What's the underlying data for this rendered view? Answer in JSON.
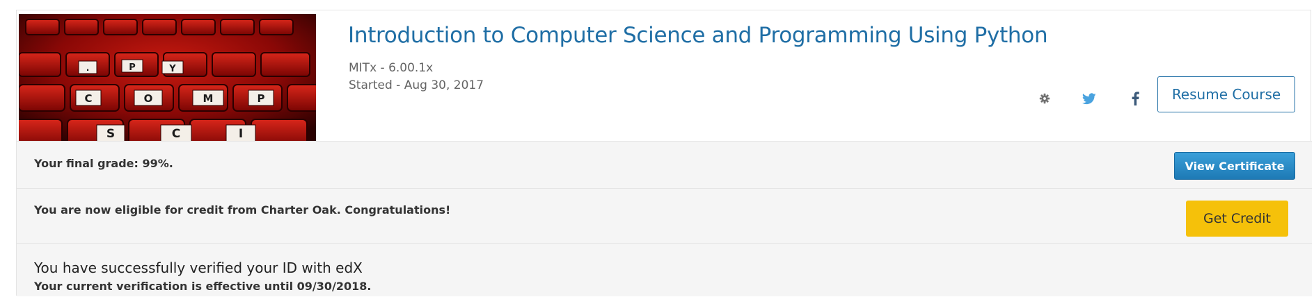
{
  "course": {
    "title": "Introduction to Computer Science and Programming Using Python",
    "org_code": "MITx - 6.00.1x",
    "started": "Started - Aug 30, 2017",
    "image_letters": [
      "P",
      "Y",
      "C",
      "O",
      "M",
      "P",
      "S",
      "C",
      "I"
    ]
  },
  "actions": {
    "settings_icon": "gear-icon",
    "twitter_icon": "twitter-icon",
    "facebook_icon": "facebook-icon",
    "resume_label": "Resume Course"
  },
  "grade": {
    "text": "Your final grade: 99%.",
    "certificate_label": "View Certificate"
  },
  "credit": {
    "text": "You are now eligible for credit from Charter Oak. Congratulations!",
    "button_label": "Get Credit"
  },
  "verification": {
    "title": "You have successfully verified your ID with edX",
    "subtitle": "Your current verification is effective until 09/30/2018."
  },
  "colors": {
    "link_blue": "#1f6ea5",
    "certificate_blue": "#2a8ac8",
    "credit_yellow": "#f5c10a",
    "twitter_blue": "#4aa3df",
    "row_background": "#f5f5f5"
  }
}
